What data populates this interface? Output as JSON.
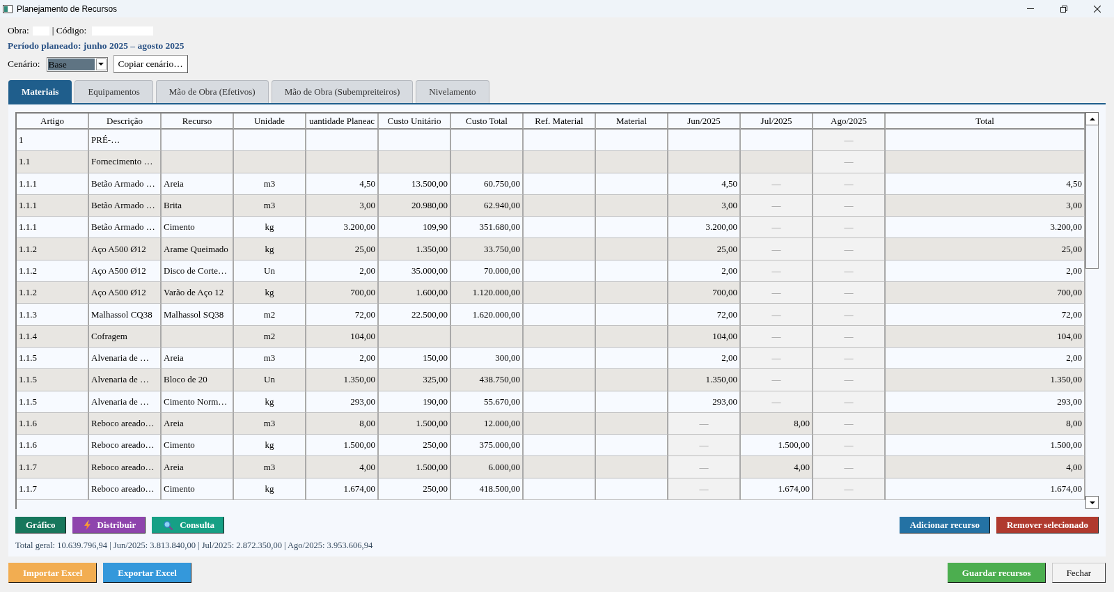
{
  "window": {
    "title": "Planejamento de Recursos"
  },
  "project": {
    "obra_label": "Obra:",
    "codigo_label": "| Código:"
  },
  "period": "Período planeado: junho 2025 – agosto 2025",
  "scenario": {
    "label": "Cenário:",
    "value": "Base",
    "copy_button": "Copiar cenário…"
  },
  "tabs": [
    {
      "label": "Materiais",
      "selected": true
    },
    {
      "label": "Equipamentos",
      "selected": false
    },
    {
      "label": "Mão de Obra (Efetivos)",
      "selected": false
    },
    {
      "label": "Mão de Obra (Subempreiteiros)",
      "selected": false
    },
    {
      "label": "Nivelamento",
      "selected": false
    }
  ],
  "table": {
    "columns": [
      "Artigo",
      "Descrição",
      "Recurso",
      "Unidade",
      "uantidade Planeac",
      "Custo Unitário",
      "Custo Total",
      "Ref. Material",
      "Material",
      "Jun/2025",
      "Jul/2025",
      "Ago/2025",
      "Total"
    ],
    "rows": [
      {
        "artigo": "1",
        "descricao": "PRÉ-…",
        "ago": {
          "value": "—",
          "disabled": true
        }
      },
      {
        "artigo": "1.1",
        "descricao": "Fornecimento …",
        "ago": {
          "value": "—",
          "disabled": true
        }
      },
      {
        "artigo": "1.1.1",
        "descricao": "Betão Armado …",
        "recurso": "Areia",
        "unidade": "m3",
        "quantidade": "4,50",
        "custo_unitario": "13.500,00",
        "custo_total": "60.750,00",
        "jun": {
          "value": "4,50",
          "disabled": false
        },
        "jul": {
          "value": "—",
          "disabled": true
        },
        "ago": {
          "value": "—",
          "disabled": true
        },
        "total": "4,50"
      },
      {
        "artigo": "1.1.1",
        "descricao": "Betão Armado …",
        "recurso": "Brita",
        "unidade": "m3",
        "quantidade": "3,00",
        "custo_unitario": "20.980,00",
        "custo_total": "62.940,00",
        "jun": {
          "value": "3,00",
          "disabled": false
        },
        "jul": {
          "value": "—",
          "disabled": true
        },
        "ago": {
          "value": "—",
          "disabled": true
        },
        "total": "3,00"
      },
      {
        "artigo": "1.1.1",
        "descricao": "Betão Armado …",
        "recurso": "Cimento",
        "unidade": "kg",
        "quantidade": "3.200,00",
        "custo_unitario": "109,90",
        "custo_total": "351.680,00",
        "jun": {
          "value": "3.200,00",
          "disabled": false
        },
        "jul": {
          "value": "—",
          "disabled": true
        },
        "ago": {
          "value": "—",
          "disabled": true
        },
        "total": "3.200,00"
      },
      {
        "artigo": "1.1.2",
        "descricao": "Aço A500 Ø12",
        "recurso": "Arame Queimado",
        "unidade": "kg",
        "quantidade": "25,00",
        "custo_unitario": "1.350,00",
        "custo_total": "33.750,00",
        "jun": {
          "value": "25,00",
          "disabled": false
        },
        "jul": {
          "value": "—",
          "disabled": true
        },
        "ago": {
          "value": "—",
          "disabled": true
        },
        "total": "25,00"
      },
      {
        "artigo": "1.1.2",
        "descricao": "Aço A500 Ø12",
        "recurso": "Disco de Corte…",
        "unidade": "Un",
        "quantidade": "2,00",
        "custo_unitario": "35.000,00",
        "custo_total": "70.000,00",
        "jun": {
          "value": "2,00",
          "disabled": false
        },
        "jul": {
          "value": "—",
          "disabled": true
        },
        "ago": {
          "value": "—",
          "disabled": true
        },
        "total": "2,00"
      },
      {
        "artigo": "1.1.2",
        "descricao": "Aço A500 Ø12",
        "recurso": "Varão de Aço 12",
        "unidade": "kg",
        "quantidade": "700,00",
        "custo_unitario": "1.600,00",
        "custo_total": "1.120.000,00",
        "jun": {
          "value": "700,00",
          "disabled": false
        },
        "jul": {
          "value": "—",
          "disabled": true
        },
        "ago": {
          "value": "—",
          "disabled": true
        },
        "total": "700,00"
      },
      {
        "artigo": "1.1.3",
        "descricao": "Malhassol CQ38",
        "recurso": "Malhassol SQ38",
        "unidade": "m2",
        "quantidade": "72,00",
        "custo_unitario": "22.500,00",
        "custo_total": "1.620.000,00",
        "jun": {
          "value": "72,00",
          "disabled": false
        },
        "jul": {
          "value": "—",
          "disabled": true
        },
        "ago": {
          "value": "—",
          "disabled": true
        },
        "total": "72,00"
      },
      {
        "artigo": "1.1.4",
        "descricao": "Cofragem",
        "unidade": "m2",
        "quantidade": "104,00",
        "jun": {
          "value": "104,00",
          "disabled": false
        },
        "jul": {
          "value": "—",
          "disabled": true
        },
        "ago": {
          "value": "—",
          "disabled": true
        },
        "total": "104,00"
      },
      {
        "artigo": "1.1.5",
        "descricao": "Alvenaria de …",
        "recurso": "Areia",
        "unidade": "m3",
        "quantidade": "2,00",
        "custo_unitario": "150,00",
        "custo_total": "300,00",
        "jun": {
          "value": "2,00",
          "disabled": false
        },
        "jul": {
          "value": "—",
          "disabled": true
        },
        "ago": {
          "value": "—",
          "disabled": true
        },
        "total": "2,00"
      },
      {
        "artigo": "1.1.5",
        "descricao": "Alvenaria de …",
        "recurso": "Bloco de 20",
        "unidade": "Un",
        "quantidade": "1.350,00",
        "custo_unitario": "325,00",
        "custo_total": "438.750,00",
        "jun": {
          "value": "1.350,00",
          "disabled": false
        },
        "jul": {
          "value": "—",
          "disabled": true
        },
        "ago": {
          "value": "—",
          "disabled": true
        },
        "total": "1.350,00"
      },
      {
        "artigo": "1.1.5",
        "descricao": "Alvenaria de …",
        "recurso": "Cimento Norm…",
        "unidade": "kg",
        "quantidade": "293,00",
        "custo_unitario": "190,00",
        "custo_total": "55.670,00",
        "jun": {
          "value": "293,00",
          "disabled": false
        },
        "jul": {
          "value": "—",
          "disabled": true
        },
        "ago": {
          "value": "—",
          "disabled": true
        },
        "total": "293,00"
      },
      {
        "artigo": "1.1.6",
        "descricao": "Reboco areado…",
        "recurso": "Areia",
        "unidade": "m3",
        "quantidade": "8,00",
        "custo_unitario": "1.500,00",
        "custo_total": "12.000,00",
        "jun": {
          "value": "—",
          "disabled": true
        },
        "jul": {
          "value": "8,00",
          "disabled": false
        },
        "ago": {
          "value": "—",
          "disabled": true
        },
        "total": "8,00"
      },
      {
        "artigo": "1.1.6",
        "descricao": "Reboco areado…",
        "recurso": "Cimento",
        "unidade": "kg",
        "quantidade": "1.500,00",
        "custo_unitario": "250,00",
        "custo_total": "375.000,00",
        "jun": {
          "value": "—",
          "disabled": true
        },
        "jul": {
          "value": "1.500,00",
          "disabled": false
        },
        "ago": {
          "value": "—",
          "disabled": true
        },
        "total": "1.500,00"
      },
      {
        "artigo": "1.1.7",
        "descricao": "Reboco areado…",
        "recurso": "Areia",
        "unidade": "m3",
        "quantidade": "4,00",
        "custo_unitario": "1.500,00",
        "custo_total": "6.000,00",
        "jun": {
          "value": "—",
          "disabled": true
        },
        "jul": {
          "value": "4,00",
          "disabled": false
        },
        "ago": {
          "value": "—",
          "disabled": true
        },
        "total": "4,00"
      },
      {
        "artigo": "1.1.7",
        "descricao": "Reboco areado…",
        "recurso": "Cimento",
        "unidade": "kg",
        "quantidade": "1.674,00",
        "custo_unitario": "250,00",
        "custo_total": "418.500,00",
        "jun": {
          "value": "—",
          "disabled": true
        },
        "jul": {
          "value": "1.674,00",
          "disabled": false
        },
        "ago": {
          "value": "—",
          "disabled": true
        },
        "total": "1.674,00"
      }
    ]
  },
  "actions_left": [
    {
      "label": "Gráfico",
      "kind": "chart"
    },
    {
      "label": "Distribuir",
      "kind": "distribute"
    },
    {
      "label": "Consulta",
      "kind": "query"
    }
  ],
  "actions_right": [
    {
      "label": "Adicionar recurso",
      "kind": "add"
    },
    {
      "label": "Remover selecionado",
      "kind": "remove"
    }
  ],
  "totals": "Total geral: 10.639.796,94 | Jun/2025: 3.813.840,00 | Jul/2025: 2.872.350,00 | Ago/2025: 3.953.606,94",
  "footer_left": [
    {
      "label": "Importar Excel",
      "kind": "import"
    },
    {
      "label": "Exportar Excel",
      "kind": "export"
    }
  ],
  "footer_right": [
    {
      "label": "Guardar recursos",
      "kind": "save"
    },
    {
      "label": "Fechar",
      "kind": "close"
    }
  ]
}
